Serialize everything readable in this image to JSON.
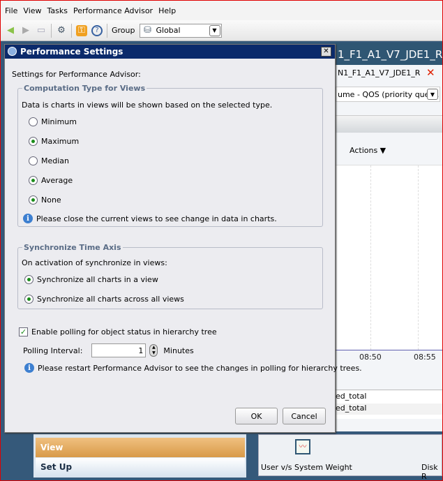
{
  "menu": [
    "File",
    "View",
    "Tasks",
    "Performance Advisor",
    "Help"
  ],
  "toolbar": {
    "group_label": "Group",
    "group_value": "Global"
  },
  "right_panel": {
    "header": "1_F1_A1_V7_JDE1_R:",
    "tab": "N1_F1_A1_V7_JDE1_R",
    "close": "✕",
    "select_value": "ume - QOS (priority queu...",
    "actions": "Actions ▼",
    "ticks": [
      "08:50",
      "08:55"
    ],
    "legend": [
      "ed_total",
      "ed_total"
    ],
    "chart_title": "User v/s System Weight",
    "chart2_title": "Disk R"
  },
  "nav": {
    "view": "View",
    "setup": "Set Up"
  },
  "dialog": {
    "title": "Performance Settings",
    "intro": "Settings for Performance Advisor:",
    "computation": {
      "legend": "Computation Type for Views",
      "desc": "Data is charts in views will be shown based on the selected type.",
      "options": [
        {
          "label": "Minimum",
          "checked": false
        },
        {
          "label": "Maximum",
          "checked": true
        },
        {
          "label": "Median",
          "checked": false
        },
        {
          "label": "Average",
          "checked": true
        },
        {
          "label": "None",
          "checked": true
        }
      ],
      "note": "Please close the current views to see change in data in charts."
    },
    "sync": {
      "legend": "Synchronize Time Axis",
      "desc": "On activation of synchronize in views:",
      "options": [
        {
          "label": "Synchronize all charts in a view",
          "checked": true
        },
        {
          "label": "Synchronize all charts across all views",
          "checked": true
        }
      ]
    },
    "polling": {
      "enable_label": "Enable polling for object status in hierarchy tree",
      "enabled": true,
      "interval_label": "Polling Interval:",
      "interval_value": "1",
      "unit": "Minutes",
      "note": "Please restart Performance Advisor to see the changes in polling for hierarchy trees."
    },
    "ok": "OK",
    "cancel": "Cancel"
  }
}
